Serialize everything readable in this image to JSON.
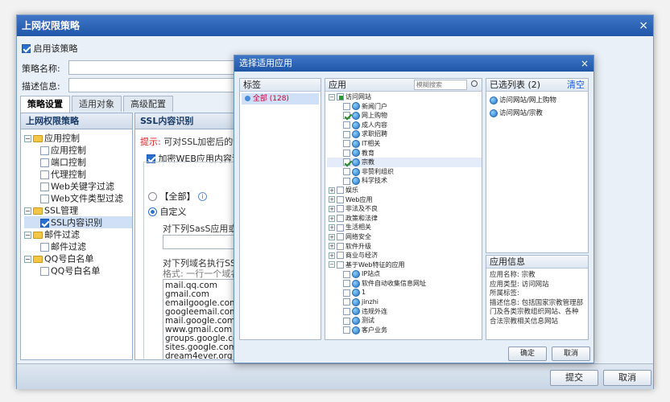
{
  "window": {
    "title": "上网权限策略",
    "close": "×"
  },
  "enable": {
    "label": "启用该策略",
    "checked": true
  },
  "form": {
    "name_label": "策略名称:",
    "desc_label": "描述信息:"
  },
  "tabs": [
    "策略设置",
    "适用对象",
    "高级配置"
  ],
  "left_tree": {
    "header": "上网权限策略",
    "items": [
      {
        "label": "应用控制",
        "level": 0,
        "type": "folder"
      },
      {
        "label": "应用控制",
        "level": 1
      },
      {
        "label": "端口控制",
        "level": 1
      },
      {
        "label": "代理控制",
        "level": 1
      },
      {
        "label": "Web关键字过滤",
        "level": 1
      },
      {
        "label": "Web文件类型过滤",
        "level": 1
      },
      {
        "label": "SSL管理",
        "level": 0,
        "type": "folder"
      },
      {
        "label": "SSL内容识别",
        "level": 1,
        "checked": true,
        "selected": true
      },
      {
        "label": "邮件过滤",
        "level": 0,
        "type": "folder"
      },
      {
        "label": "邮件过滤",
        "level": 1
      },
      {
        "label": "QQ号白名单",
        "level": 0,
        "type": "folder"
      },
      {
        "label": "QQ号白名单",
        "level": 1
      }
    ]
  },
  "ssl": {
    "header": "SSL内容识别",
    "hint_prefix": "提示:",
    "hint_text": "可对SSL加密后的web",
    "encrypt_label": "加密WEB应用内容识别",
    "opt_all": "【全部】",
    "opt_custom": "自定义",
    "sass_label": "对下列SasS应用或者",
    "domain_label": "对下列域名执行SSL内",
    "format_label": "格式: 一行一个域名,",
    "domains": [
      "mail.qq.com",
      "gmail.com",
      "emailgoogle.com",
      "googleemail.com",
      "mail.google.com",
      "www.gmail.com",
      "groups.google.com",
      "sites.google.com",
      "dream4ever.org"
    ]
  },
  "footer": {
    "submit": "提交",
    "cancel": "取消"
  },
  "dialog": {
    "title": "选择适用应用",
    "close": "×",
    "tags": {
      "header": "标签",
      "items": [
        "全部 (128)"
      ]
    },
    "apps": {
      "header": "应用",
      "search_placeholder": "模糊搜索",
      "items": [
        {
          "label": "访问网站",
          "level": 0,
          "toggle": "⊟",
          "state": "part"
        },
        {
          "label": "新闻门户",
          "level": 1
        },
        {
          "label": "网上购物",
          "level": 1,
          "checked": true
        },
        {
          "label": "成人内容",
          "level": 1
        },
        {
          "label": "求职招聘",
          "level": 1
        },
        {
          "label": "IT相关",
          "level": 1
        },
        {
          "label": "教育",
          "level": 1
        },
        {
          "label": "宗教",
          "level": 1,
          "checked": true,
          "selected": true
        },
        {
          "label": "非赞利组织",
          "level": 1
        },
        {
          "label": "科学技术",
          "level": 1
        },
        {
          "label": "娱乐",
          "level": 0,
          "toggle": "⊞"
        },
        {
          "label": "Web应用",
          "level": 0,
          "toggle": "⊞"
        },
        {
          "label": "非法及不良",
          "level": 0,
          "toggle": "⊞"
        },
        {
          "label": "政策和法律",
          "level": 0,
          "toggle": "⊞"
        },
        {
          "label": "生活相关",
          "level": 0,
          "toggle": "⊞"
        },
        {
          "label": "网络安全",
          "level": 0,
          "toggle": "⊞"
        },
        {
          "label": "软件升级",
          "level": 0,
          "toggle": "⊞"
        },
        {
          "label": "商业与经济",
          "level": 0,
          "toggle": "⊞"
        },
        {
          "label": "基于Web特征的应用",
          "level": 0,
          "toggle": "⊟"
        },
        {
          "label": "IP站点",
          "level": 1
        },
        {
          "label": "软件自动收集信息网址",
          "level": 1
        },
        {
          "label": "1",
          "level": 1
        },
        {
          "label": "jinzhi",
          "level": 1
        },
        {
          "label": "违规外连",
          "level": 1
        },
        {
          "label": "测试",
          "level": 1
        },
        {
          "label": "客户业务",
          "level": 1
        }
      ]
    },
    "selected": {
      "header": "已选列表",
      "count": "(2)",
      "clear": "清空",
      "items": [
        "访问网站/网上购物",
        "访问网站/宗教"
      ]
    },
    "info": {
      "header": "应用信息",
      "name_label": "应用名称:",
      "name": "宗教",
      "type_label": "应用类型:",
      "type": "访问网站",
      "owner_label": "所属标签:",
      "owner": "",
      "desc_label": "描述信息:",
      "desc": "包括国家宗教管理部门及各类宗教组织网站、各种合法宗教相关信息网站"
    },
    "ok": "确定",
    "cancel": "取消"
  }
}
